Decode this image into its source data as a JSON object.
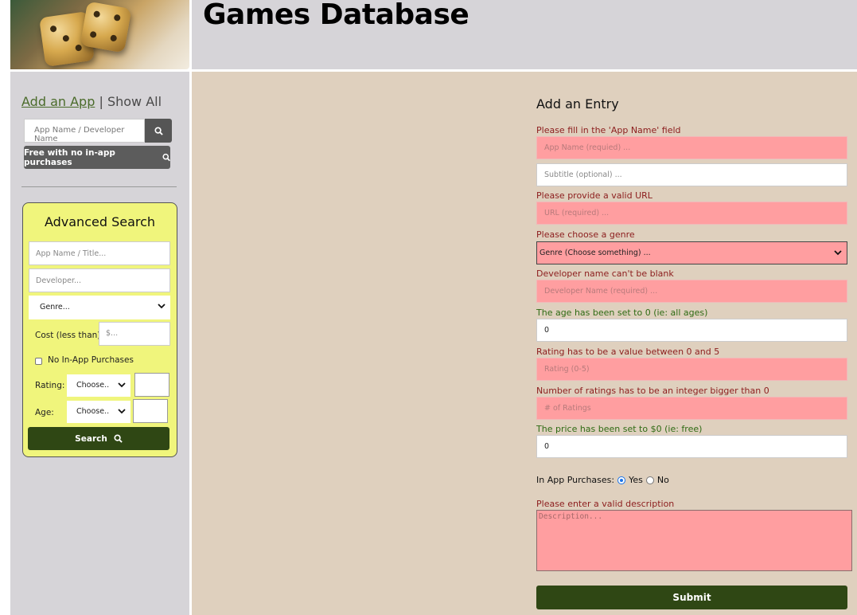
{
  "header": {
    "title": "Games Database",
    "logo_icon": "dice-icon"
  },
  "sidebar": {
    "add_app_link": "Add an App",
    "separator": "|",
    "show_all_link": "Show All",
    "quick_search": {
      "placeholder": "App Name / Developer Name",
      "button_icon": "search-icon"
    },
    "free_button_label": "Free with no in-app purchases",
    "advanced": {
      "title": "Advanced Search",
      "title_placeholder": "App Name / Title...",
      "developer_placeholder": "Developer...",
      "genre_value": "Genre...",
      "cost_label": "Cost (less than):",
      "cost_placeholder": "$...",
      "no_iap_label": "No In-App Purchases",
      "rating_label": "Rating:",
      "rating_select": "Choose..",
      "age_label": "Age:",
      "age_select": "Choose..",
      "search_button": "Search",
      "background_color": "#f0f57c"
    }
  },
  "form": {
    "title": "Add an Entry",
    "app_name_msg": "Please fill in the 'App Name' field",
    "app_name_placeholder": "App Name (requied) ...",
    "subtitle_placeholder": "Subtitle (optional) ...",
    "url_msg": "Please provide a valid URL",
    "url_placeholder": "URL (required) ...",
    "genre_msg": "Please choose a genre",
    "genre_value": "Genre (Choose something) ...",
    "developer_msg": "Developer name can't be blank",
    "developer_placeholder": "Developer Name (required) ...",
    "age_msg": "The age has been set to 0 (ie: all ages)",
    "age_value": "0",
    "rating_msg": "Rating has to be a value between 0 and 5",
    "rating_placeholder": "Rating (0-5)",
    "num_ratings_msg": "Number of ratings has to be an integer bigger than 0",
    "num_ratings_placeholder": "# of Ratings",
    "price_msg": "The price has been set to $0 (ie: free)",
    "price_value": "0",
    "iap_label": "In App Purchases:",
    "iap_yes": "Yes",
    "iap_no": "No",
    "description_msg": "Please enter a valid description",
    "description_placeholder": "Description...",
    "submit_label": "Submit",
    "error_color": "#ff9ea0",
    "button_color": "#2f4714"
  }
}
